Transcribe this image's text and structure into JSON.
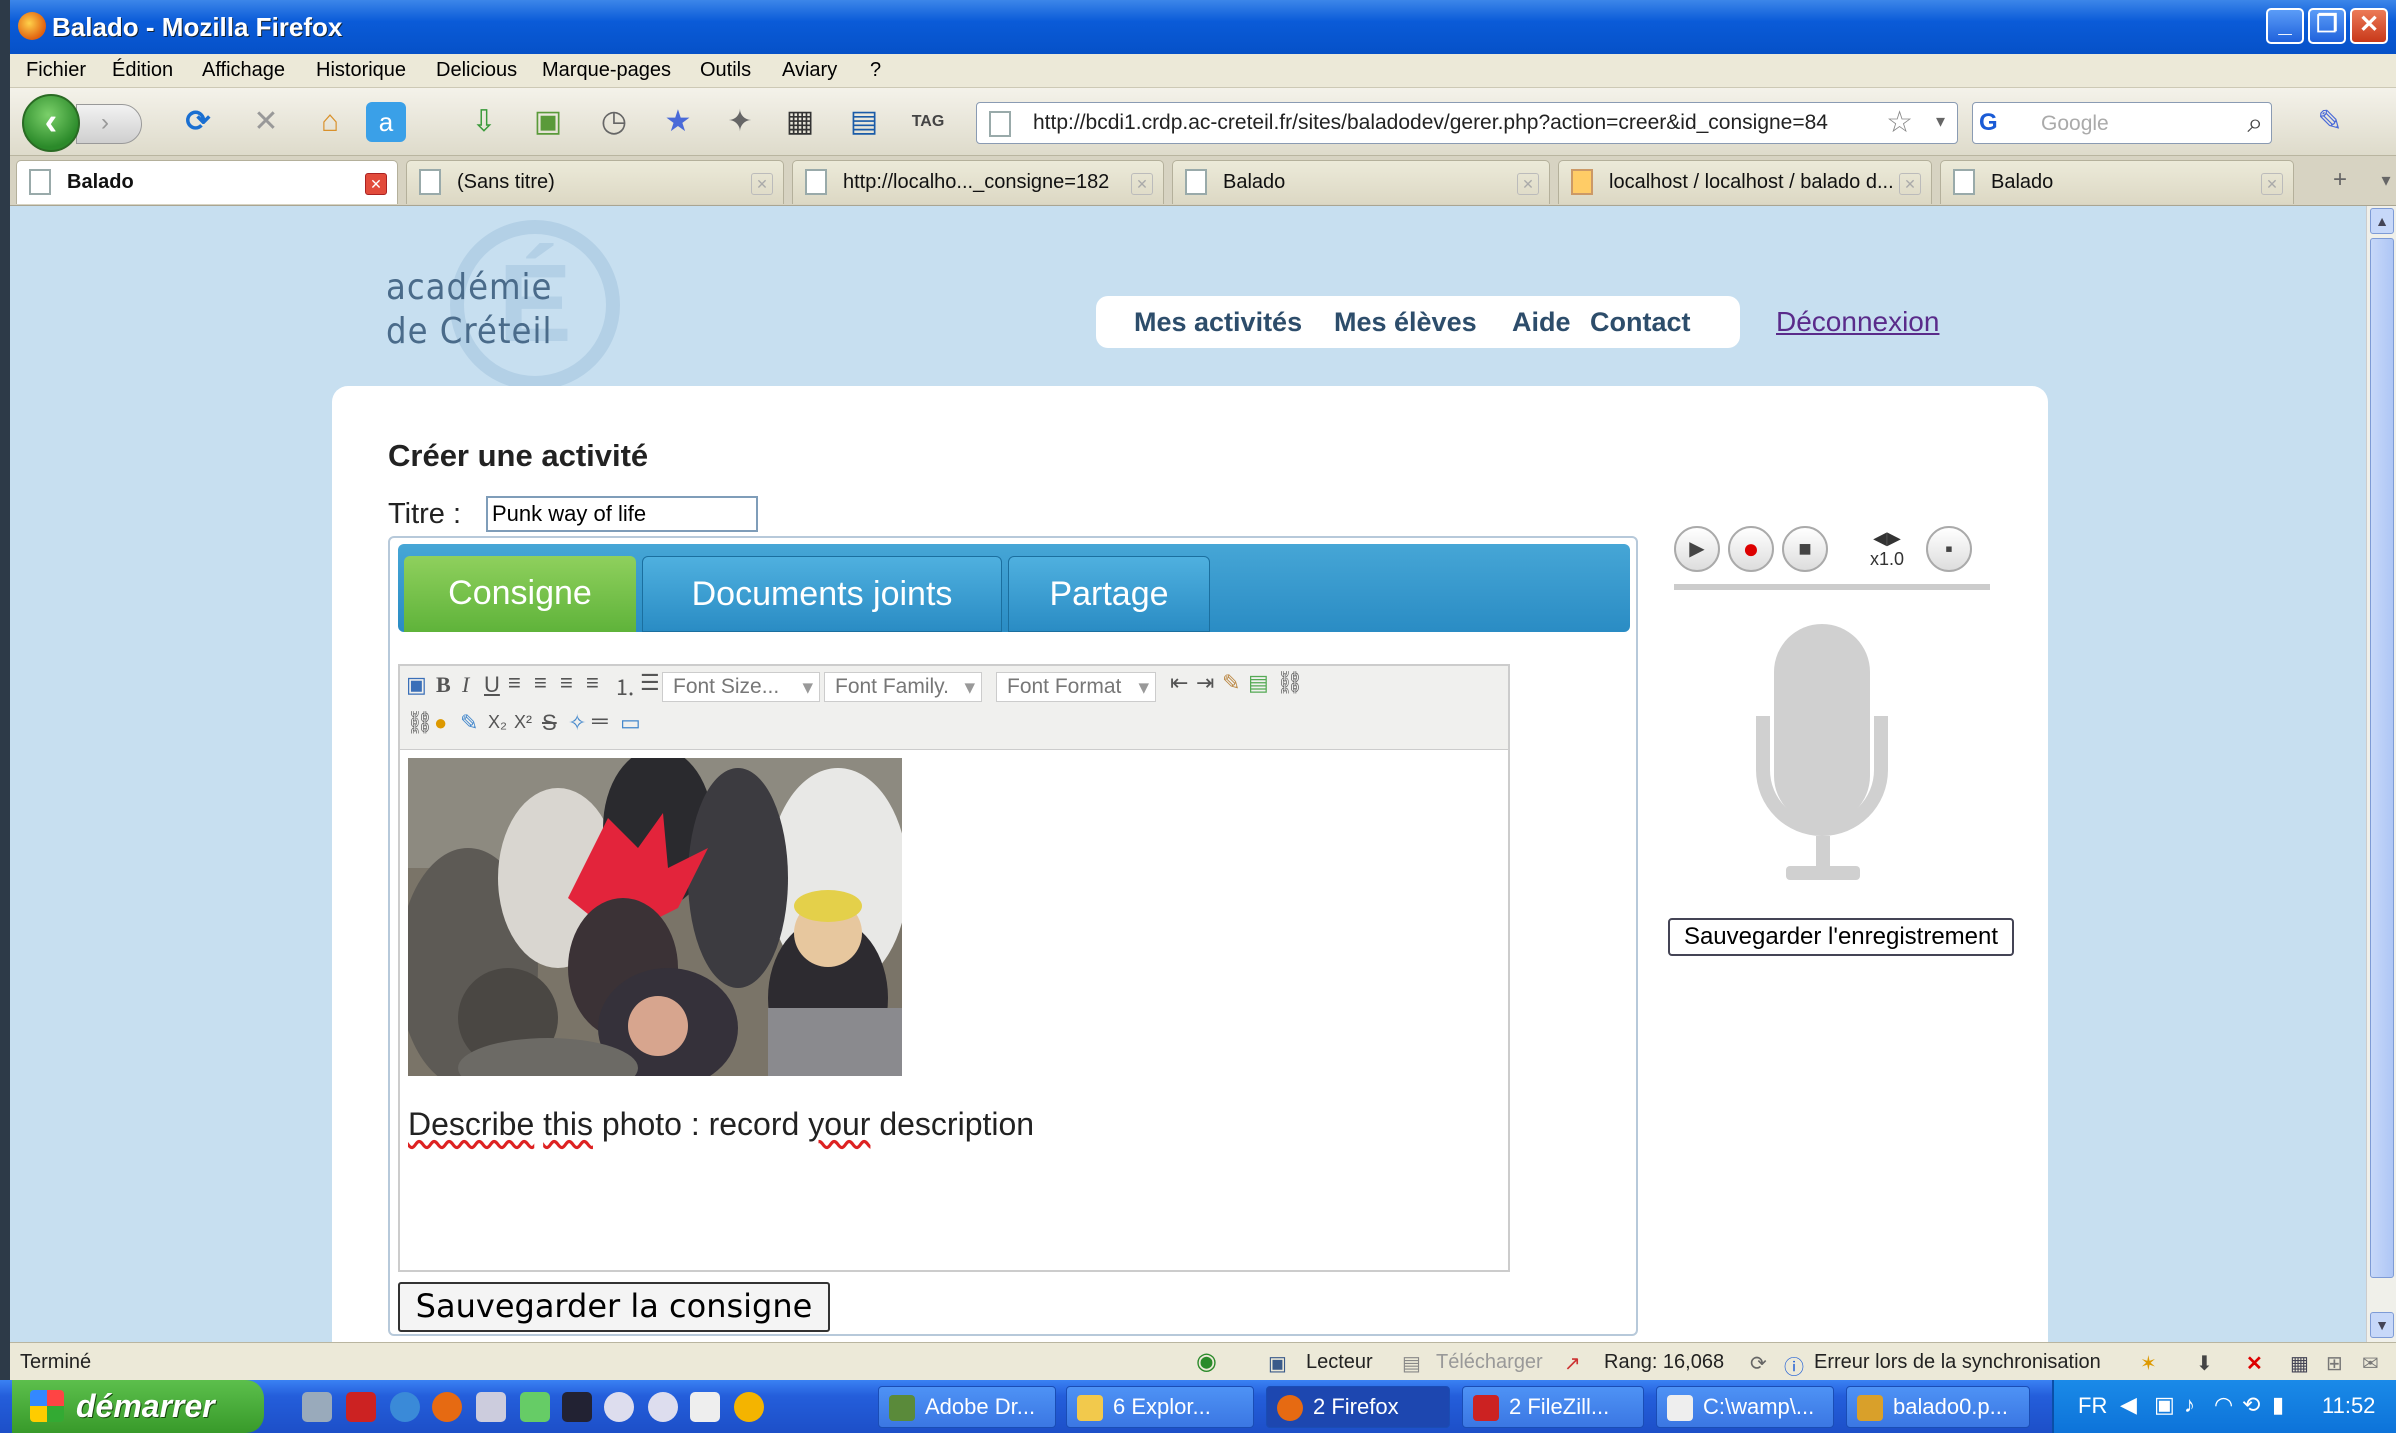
{
  "window": {
    "title": "Balado - Mozilla Firefox",
    "min": "_",
    "max": "❐",
    "close": "✕"
  },
  "menu": [
    "Fichier",
    "Édition",
    "Affichage",
    "Historique",
    "Delicious",
    "Marque-pages",
    "Outils",
    "Aviary",
    "?"
  ],
  "nav": {
    "url": "http://bcdi1.crdp.ac-creteil.fr/sites/baladodev/gerer.php?action=creer&id_consigne=84",
    "search_placeholder": "Google"
  },
  "tabs": [
    {
      "label": "Balado",
      "active": true
    },
    {
      "label": "(Sans titre)"
    },
    {
      "label": "http://localho..._consigne=182"
    },
    {
      "label": "Balado"
    },
    {
      "label": "localhost / localhost / balado d..."
    },
    {
      "label": "Balado"
    }
  ],
  "site": {
    "logo_line1": "académie",
    "logo_line2": "de Créteil",
    "nav": [
      "Mes activités",
      "Mes élèves",
      "Aide",
      "Contact"
    ],
    "logout": "Déconnexion"
  },
  "page": {
    "heading": "Créer une activité",
    "titre_label": "Titre :",
    "titre_value": "Punk way of life",
    "tabs": [
      "Consigne",
      "Documents joints",
      "Partage"
    ],
    "editor": {
      "font_size": "Font Size...",
      "font_family": "Font Family.",
      "font_format": "Font Format",
      "text_words": [
        "Describe",
        "this",
        "photo :",
        "record",
        "your",
        "description"
      ]
    },
    "save_consigne": "Sauvegarder la consigne",
    "recorder": {
      "speed": "x1.0",
      "save": "Sauvegarder l'enregistrement"
    }
  },
  "status": {
    "left": "Terminé",
    "lecteur": "Lecteur",
    "telecharger": "Télécharger",
    "rang": "Rang: 16,068",
    "sync": "Erreur lors de la synchronisation"
  },
  "taskbar": {
    "start": "démarrer",
    "tasks": [
      "Adobe Dr...",
      "6 Explor...",
      "2 Firefox",
      "2 FileZill...",
      "C:\\wamp\\...",
      "balado0.p..."
    ],
    "lang": "FR",
    "clock": "11:52"
  },
  "colors": {
    "accent_green": "#5fb33a",
    "accent_blue": "#2a8cc4",
    "page_bg": "#c7dff0"
  }
}
